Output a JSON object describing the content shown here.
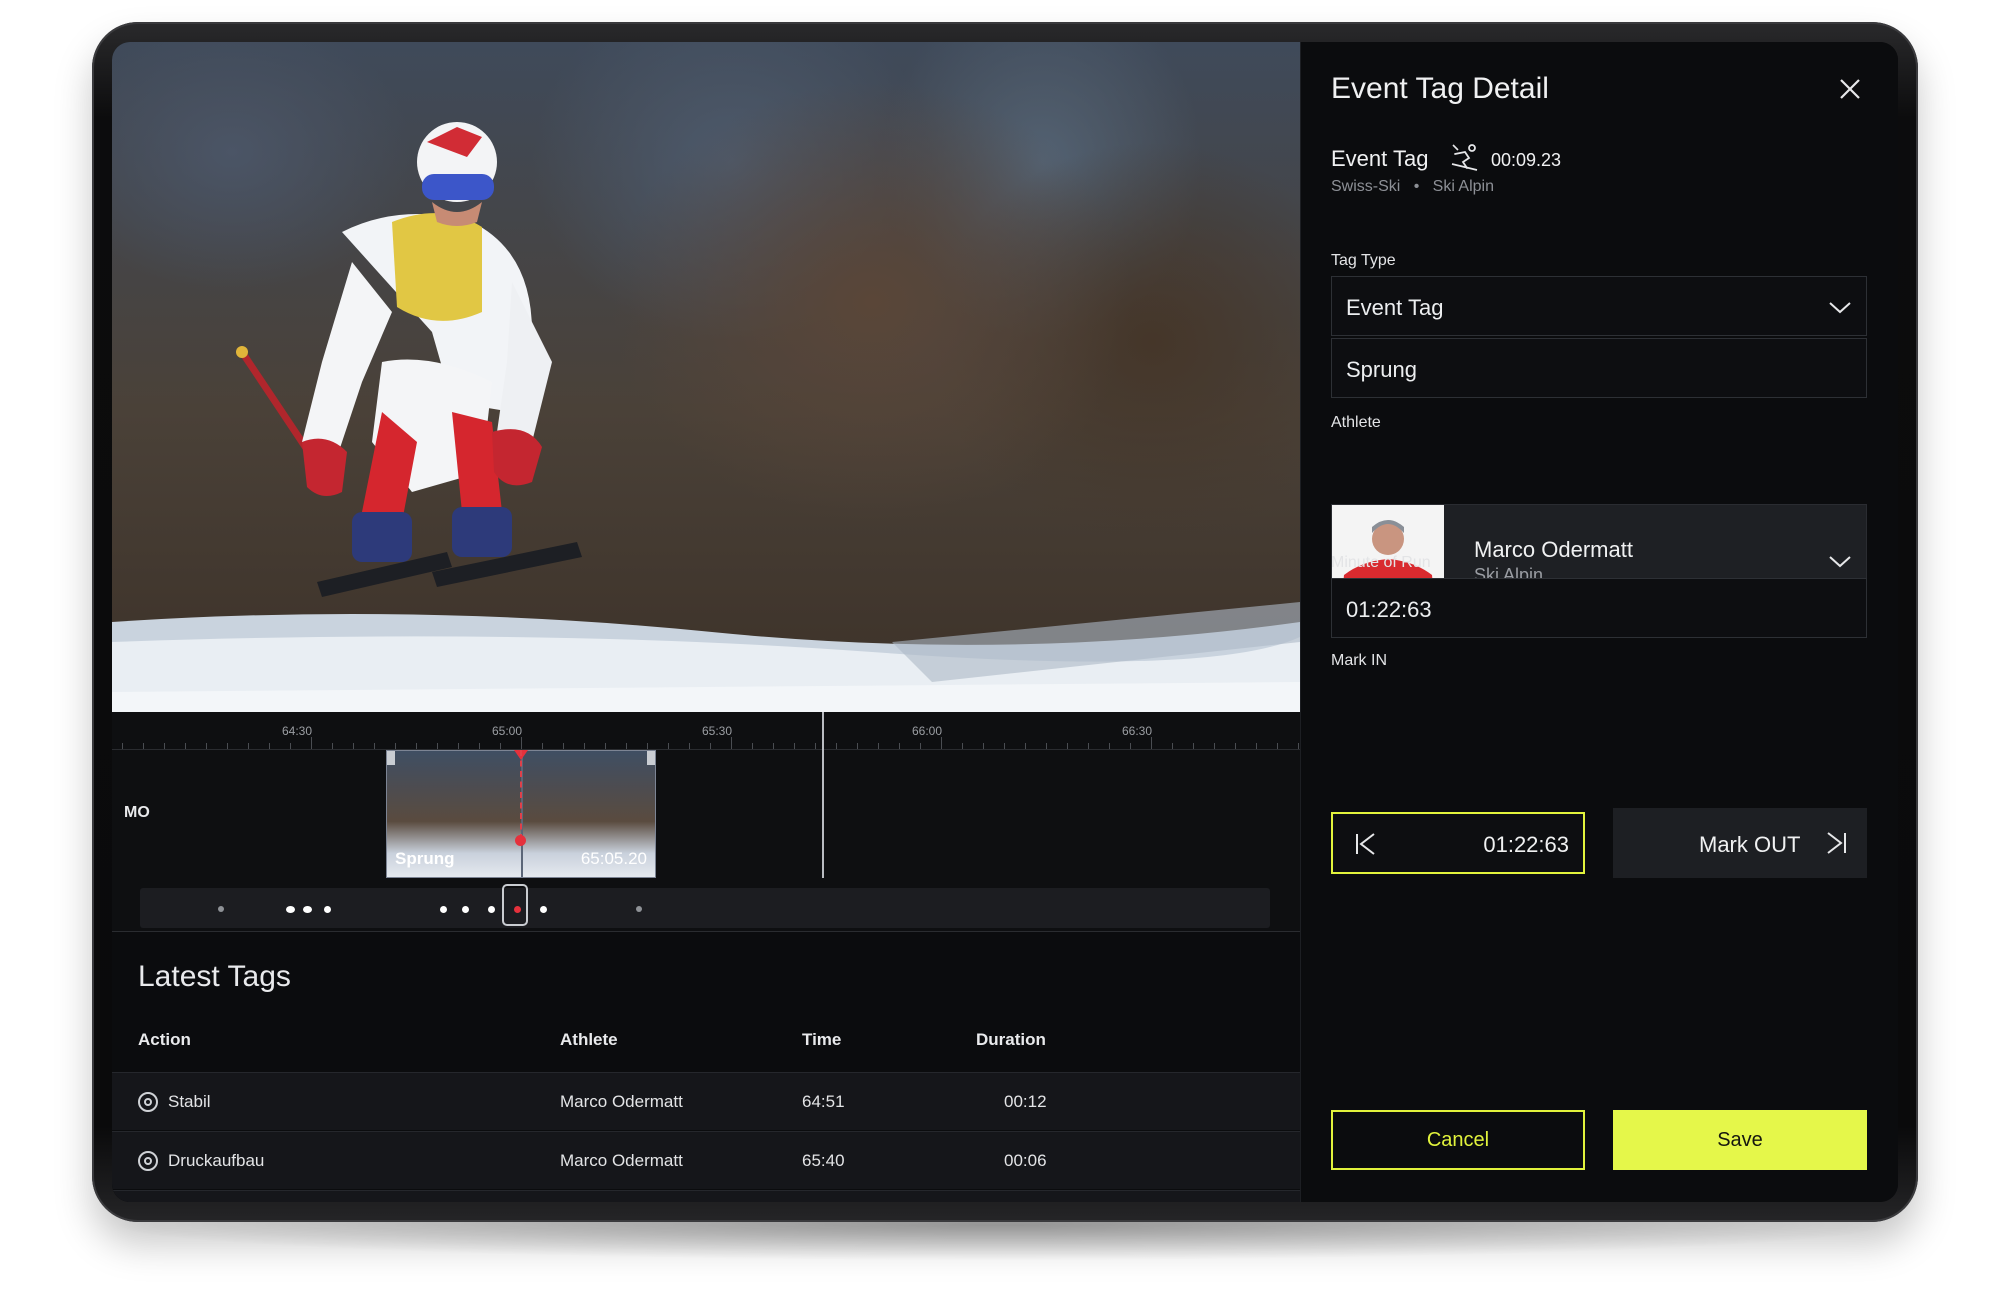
{
  "colors": {
    "accent": "#e5f74a",
    "playhead": "#e5313c",
    "background": "#0b0c0e"
  },
  "timeline": {
    "ticks": [
      "64:30",
      "65:00",
      "65:30",
      "66:00",
      "66:30"
    ],
    "track_label": "MO",
    "clip": {
      "name": "Sprung",
      "time": "65:05.20"
    }
  },
  "latest_tags": {
    "title": "Latest Tags",
    "columns": [
      "Action",
      "Athlete",
      "Time",
      "Duration"
    ],
    "rows": [
      {
        "action": "Stabil",
        "athlete": "Marco Odermatt",
        "time": "64:51",
        "duration": "00:12"
      },
      {
        "action": "Druckaufbau",
        "athlete": "Marco Odermatt",
        "time": "65:40",
        "duration": "00:06"
      }
    ]
  },
  "panel": {
    "title": "Event Tag Detail",
    "close_icon": "close-icon",
    "event_label": "Event Tag",
    "event_icon": "skier-icon",
    "event_time": "00:09.23",
    "meta_org": "Swiss-Ski",
    "meta_sport": "Ski Alpin",
    "tag_type_label": "Tag Type",
    "tag_type_value": "Event Tag",
    "tag_name_value": "Sprung",
    "athlete_label": "Athlete",
    "athlete_name": "Marco Odermatt",
    "athlete_sport": "Ski Alpin",
    "minute_label": "Minute of Run",
    "minute_value": "01:22:63",
    "mark_in_label": "Mark IN",
    "mark_in_value": "01:22:63",
    "mark_out_label": "Mark OUT",
    "cancel_label": "Cancel",
    "save_label": "Save"
  }
}
